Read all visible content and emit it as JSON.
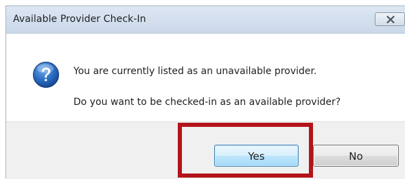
{
  "window": {
    "title": "Available Provider Check-In"
  },
  "message": {
    "line1": "You are currently listed as an unavailable provider.",
    "line2": "Do you want to be checked-in as an available provider?"
  },
  "icons": {
    "dialog_icon": "question-icon",
    "close": "close-icon"
  },
  "buttons": {
    "yes_label": "Yes",
    "no_label": "No"
  },
  "colors": {
    "highlight": "#b3131a",
    "title_bar": "#cad8ea",
    "question_icon": "#1f5fb0"
  }
}
